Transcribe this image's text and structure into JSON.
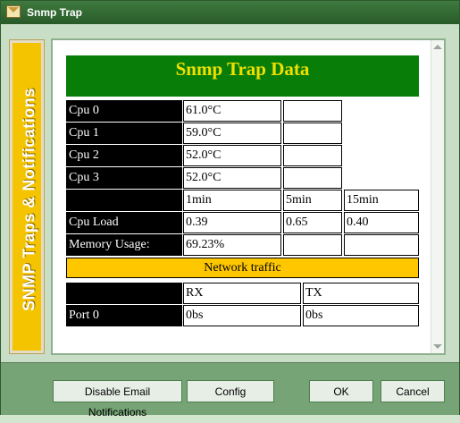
{
  "window": {
    "title": "Snmp Trap"
  },
  "side_banner": {
    "text": "SNMP Traps & Notifications"
  },
  "data_panel": {
    "heading": "Snmp Trap Data",
    "cpu_rows": [
      {
        "label": "Cpu 0",
        "value": "61.0°C",
        "extra": ""
      },
      {
        "label": "Cpu 1",
        "value": "59.0°C",
        "extra": ""
      },
      {
        "label": "Cpu 2",
        "value": "52.0°C",
        "extra": ""
      },
      {
        "label": "Cpu 3",
        "value": "52.0°C",
        "extra": ""
      }
    ],
    "load_headers": [
      "",
      "1min",
      "5min",
      "15min"
    ],
    "cpu_load": {
      "label": "Cpu Load",
      "values": [
        "0.39",
        "0.65",
        "0.40"
      ]
    },
    "memory": {
      "label": "Memory Usage:",
      "value": "69.23%",
      "extra1": "",
      "extra2": ""
    },
    "network": {
      "title": "Network traffic",
      "headers": [
        "",
        "RX",
        "TX"
      ],
      "rows": [
        {
          "label": "Port 0",
          "rx": "0bs",
          "tx": "0bs"
        }
      ]
    }
  },
  "buttons": {
    "disable_email": "Disable Email Notifications",
    "config": "Config",
    "ok": "OK",
    "cancel": "Cancel"
  }
}
